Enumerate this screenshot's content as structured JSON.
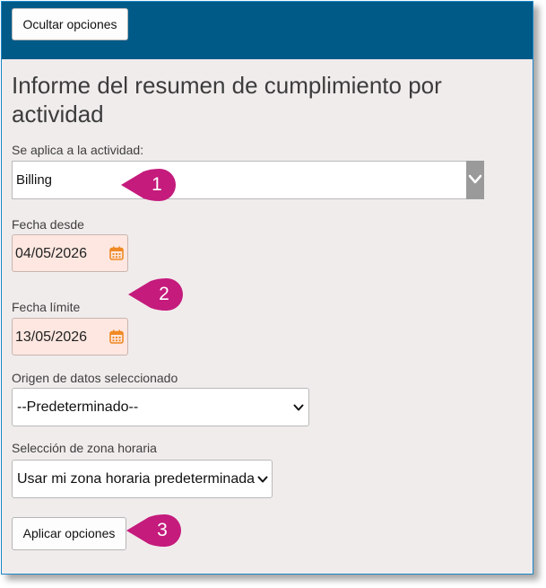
{
  "header": {
    "hide_options_label": "Ocultar opciones"
  },
  "page_title": "Informe del resumen de cumplimiento por actividad",
  "activity": {
    "label": "Se aplica a la actividad:",
    "value": "Billing"
  },
  "date_from": {
    "label": "Fecha desde",
    "value": "04/05/2026"
  },
  "date_to": {
    "label": "Fecha límite",
    "value": "13/05/2026"
  },
  "data_source": {
    "label": "Origen de datos seleccionado",
    "value": "--Predeterminado--"
  },
  "timezone": {
    "label": "Selección de zona horaria",
    "value": "Usar mi zona horaria predeterminada"
  },
  "apply_label": "Aplicar opciones",
  "callouts": [
    "1",
    "2",
    "3"
  ],
  "colors": {
    "header": "#005a87",
    "callout": "#c41b7c",
    "date_bg": "#fde7e0",
    "calendar_icon": "#f08a24",
    "panel": "#f1ecec"
  },
  "icons": [
    "calendar-icon",
    "chevron-down-icon"
  ]
}
